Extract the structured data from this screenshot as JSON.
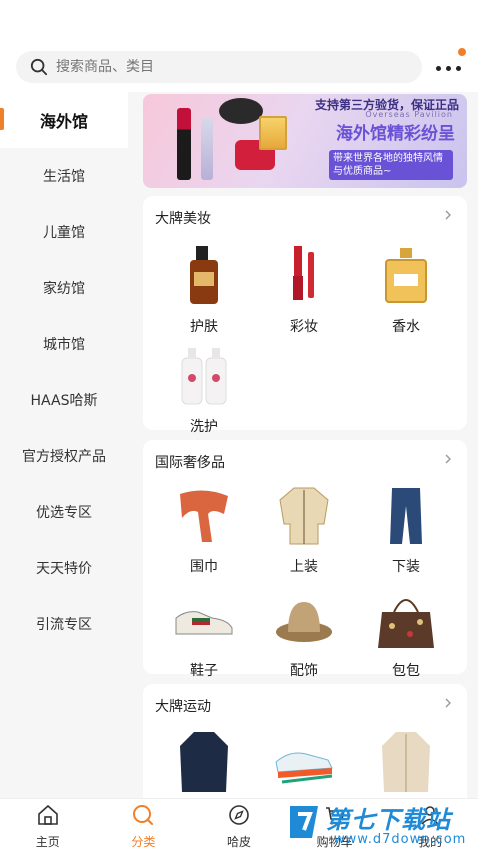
{
  "search": {
    "placeholder": "搜索商品、类目"
  },
  "sidebar": {
    "items": [
      {
        "label": "海外馆",
        "active": true
      },
      {
        "label": "生活馆"
      },
      {
        "label": "儿童馆"
      },
      {
        "label": "家纺馆"
      },
      {
        "label": "城市馆"
      },
      {
        "label": "HAAS哈斯"
      },
      {
        "label": "官方授权产品"
      },
      {
        "label": "优选专区"
      },
      {
        "label": "天天特价"
      },
      {
        "label": "引流专区"
      }
    ]
  },
  "banner": {
    "line1": "支持第三方验货，保证正品",
    "line2": "Overseas Pavilion",
    "line3": "海外馆精彩纷呈",
    "line4": "带来世界各地的独特风情与优质商品~"
  },
  "sections": [
    {
      "title": "大牌美妆",
      "items": [
        "护肤",
        "彩妆",
        "香水",
        "洗护"
      ]
    },
    {
      "title": "国际奢侈品",
      "items": [
        "围巾",
        "上装",
        "下装",
        "鞋子",
        "配饰",
        "包包"
      ]
    },
    {
      "title": "大牌运动",
      "items": []
    }
  ],
  "tabbar": {
    "items": [
      {
        "label": "主页",
        "icon": "home-icon"
      },
      {
        "label": "分类",
        "icon": "category-icon",
        "active": true
      },
      {
        "label": "哈皮",
        "icon": "compass-icon"
      },
      {
        "label": "购物车",
        "icon": "cart-icon"
      },
      {
        "label": "我的",
        "icon": "user-icon"
      }
    ]
  },
  "watermark": {
    "title": "第七下载站",
    "url": "www.d7down.com"
  },
  "colors": {
    "accent": "#f07f2a",
    "sidebar_bg": "#f6f6f6",
    "watermark": "#1f8bd6"
  }
}
